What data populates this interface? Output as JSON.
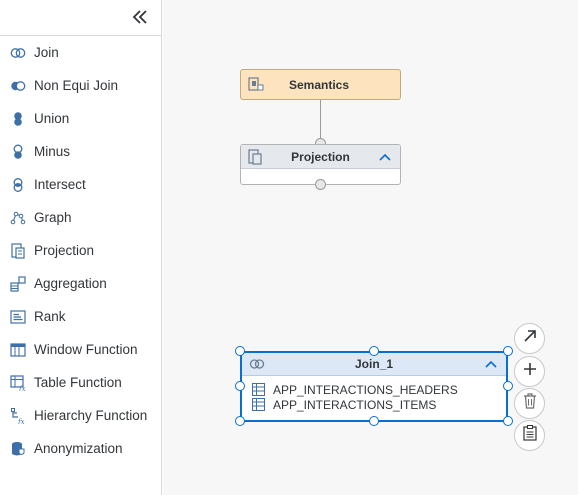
{
  "sidebar": {
    "collapse_icon": "double-chevron-left-icon",
    "items": [
      {
        "label": "Join",
        "icon": "join-icon"
      },
      {
        "label": "Non Equi Join",
        "icon": "non-equi-join-icon"
      },
      {
        "label": "Union",
        "icon": "union-icon"
      },
      {
        "label": "Minus",
        "icon": "minus-icon"
      },
      {
        "label": "Intersect",
        "icon": "intersect-icon"
      },
      {
        "label": "Graph",
        "icon": "graph-icon"
      },
      {
        "label": "Projection",
        "icon": "projection-icon"
      },
      {
        "label": "Aggregation",
        "icon": "aggregation-icon"
      },
      {
        "label": "Rank",
        "icon": "rank-icon"
      },
      {
        "label": "Window Function",
        "icon": "window-function-icon"
      },
      {
        "label": "Table Function",
        "icon": "table-function-icon"
      },
      {
        "label": "Hierarchy Function",
        "icon": "hierarchy-function-icon"
      },
      {
        "label": "Anonymization",
        "icon": "anonymization-icon"
      }
    ]
  },
  "canvas": {
    "semantics_node": {
      "title": "Semantics",
      "icon": "semantics-icon"
    },
    "projection_node": {
      "title": "Projection",
      "icon": "projection-icon"
    },
    "join_node": {
      "title": "Join_1",
      "icon": "join-icon",
      "tables": [
        "APP_INTERACTIONS_HEADERS",
        "APP_INTERACTIONS_ITEMS"
      ]
    },
    "actions": [
      "expand-arrow-icon",
      "add-icon",
      "delete-icon",
      "clipboard-icon"
    ]
  },
  "colors": {
    "accent": "#0a6ed1",
    "semantics_fill": "#fde4bf",
    "header_gray": "#e5e8ec",
    "icon_blue": "#3f6fa8"
  }
}
